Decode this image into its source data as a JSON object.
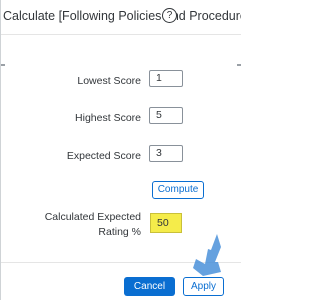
{
  "dialog": {
    "title": "Calculate [Following Policies and Procedures] E...",
    "help_icon": "help-icon"
  },
  "fields": {
    "lowest_score": {
      "label": "Lowest Score",
      "value": "1"
    },
    "highest_score": {
      "label": "Highest Score",
      "value": "5"
    },
    "expected_score": {
      "label": "Expected Score",
      "value": "3"
    }
  },
  "compute": {
    "label": "Compute"
  },
  "result": {
    "label": "Calculated Expected Rating %",
    "value": "50",
    "highlight_color": "#f5ec4a"
  },
  "footer": {
    "cancel_label": "Cancel",
    "apply_label": "Apply"
  },
  "annotation": {
    "icon": "arrow-pointer-icon",
    "color": "#4a90d9"
  },
  "colors": {
    "accent": "#0a6ed1",
    "text": "#32363a"
  }
}
